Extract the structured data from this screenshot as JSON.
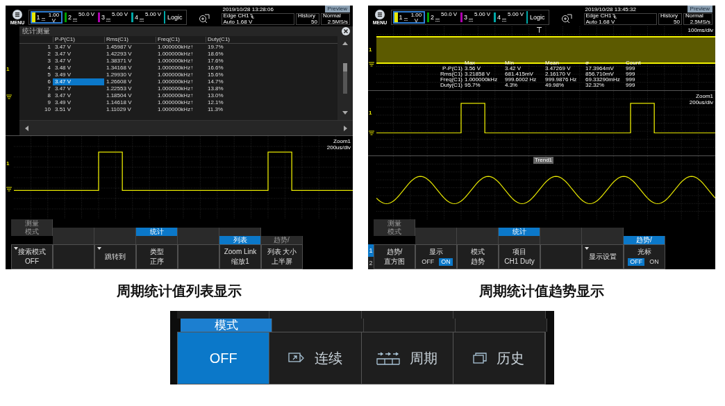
{
  "list_screen": {
    "header": {
      "menu_label": "MENU",
      "channels": [
        {
          "number": "1",
          "scale": "1.00 V",
          "color": "#e8e800",
          "selected": true
        },
        {
          "number": "2",
          "scale": "50.0 V",
          "color": "#00a000",
          "selected": false
        },
        {
          "number": "3",
          "scale": "5.00 V",
          "color": "#b000b0",
          "selected": false
        },
        {
          "number": "4",
          "scale": "5.00 V",
          "color": "#00a8a8",
          "selected": false
        }
      ],
      "logic": "Logic",
      "datetime": "2019/10/28 13:28:06",
      "preview": "Preview",
      "trigger": "Edge CH1",
      "trigger_level": "Auto 1.68 V",
      "history_label": "History",
      "history_value": "50",
      "acq_mode": "Normal",
      "sample_rate": "2.5MS/s"
    },
    "stats_window": {
      "title": "统计测量",
      "channel_marker": "1",
      "columns": [
        "P-P(C1)",
        "Rms(C1)",
        "Freq(C1)",
        "Duty(C1)"
      ],
      "rows": [
        {
          "index": "1",
          "cells": [
            "3.47 V",
            "1.45987 V",
            "1.000000kHz↑",
            "19.7%"
          ],
          "selected": false
        },
        {
          "index": "2",
          "cells": [
            "3.47 V",
            "1.42293 V",
            "1.000000kHz↑",
            "18.6%"
          ],
          "selected": false
        },
        {
          "index": "3",
          "cells": [
            "3.47 V",
            "1.38371 V",
            "1.000000kHz↑",
            "17.6%"
          ],
          "selected": false
        },
        {
          "index": "4",
          "cells": [
            "3.48 V",
            "1.34168 V",
            "1.000000kHz↑",
            "16.6%"
          ],
          "selected": false
        },
        {
          "index": "5",
          "cells": [
            "3.49 V",
            "1.29930 V",
            "1.000000kHz↑",
            "15.6%"
          ],
          "selected": false
        },
        {
          "index": "6",
          "cells": [
            "3.47 V",
            "1.26608 V",
            "1.000000kHz↑",
            "14.7%"
          ],
          "selected": true
        },
        {
          "index": "7",
          "cells": [
            "3.47 V",
            "1.22553 V",
            "1.000000kHz↑",
            "13.8%"
          ],
          "selected": false
        },
        {
          "index": "8",
          "cells": [
            "3.47 V",
            "1.18504 V",
            "1.000000kHz↑",
            "13.0%"
          ],
          "selected": false
        },
        {
          "index": "9",
          "cells": [
            "3.49 V",
            "1.14618 V",
            "1.000000kHz↑",
            "12.1%"
          ],
          "selected": false
        },
        {
          "index": "10",
          "cells": [
            "3.51 V",
            "1.11029 V",
            "1.000000kHz↑",
            "11.3%"
          ],
          "selected": false
        }
      ]
    },
    "zoom_display": {
      "title": "Zoom1",
      "timebase": "200us/div",
      "channel_marker": "1"
    },
    "menu": {
      "layers": [
        [
          {
            "label": "测量",
            "selected": false
          }
        ],
        [
          {
            "label": "模式",
            "selected": false
          },
          {
            "selected": false
          },
          {
            "selected": false
          },
          {
            "label": "统计",
            "selected": true
          },
          {
            "selected": false
          },
          {
            "selected": false
          }
        ],
        [
          {
            "selected": false
          },
          {
            "selected": false
          },
          {
            "selected": false
          },
          {
            "selected": false
          },
          {
            "label": "列表",
            "selected": true
          },
          {
            "label": "趋势/",
            "selected": false
          }
        ]
      ],
      "softkeys": [
        {
          "kind": "value",
          "label": "搜索模式",
          "value": "OFF",
          "dropdown": true
        },
        {
          "kind": "blank"
        },
        {
          "kind": "action",
          "lines": [
            "跳转到"
          ],
          "dropdown": true
        },
        {
          "kind": "value",
          "label": "类型",
          "value": "正序",
          "dropdown": false
        },
        {
          "kind": "blank"
        },
        {
          "kind": "value",
          "label": "Zoom Link",
          "value": "缩放1",
          "dropdown": false
        },
        {
          "kind": "value",
          "label": "列表 大小",
          "value": "上半屏",
          "dropdown": false
        }
      ]
    }
  },
  "list_caption": "周期统计值列表显示",
  "trend_screen": {
    "header": {
      "menu_label": "MENU",
      "channels": [
        {
          "number": "1",
          "scale": "1.00 V",
          "color": "#e8e800",
          "selected": true
        },
        {
          "number": "2",
          "scale": "50.0 V",
          "color": "#00a000",
          "selected": false
        },
        {
          "number": "3",
          "scale": "5.00 V",
          "color": "#b000b0",
          "selected": false
        },
        {
          "number": "4",
          "scale": "5.00 V",
          "color": "#00a8a8",
          "selected": false
        }
      ],
      "logic": "Logic",
      "datetime": "2019/10/28 13:45:32",
      "preview": "Preview",
      "trigger": "Edge CH1",
      "trigger_level": "Auto 1.68 V",
      "history_label": "History",
      "history_value": "50",
      "acq_mode": "Normal",
      "sample_rate": "2.5MS/s"
    },
    "overview": {
      "timebase": "100ms/div",
      "channel_marker": "1",
      "stats": {
        "columns": [
          "Max",
          "Min",
          "Mean",
          "σ",
          "Count"
        ],
        "rows": [
          {
            "label": "P-P(C1)",
            "cells": [
              "3.56 V",
              "3.42 V",
              "3.47269 V",
              "17.3964mV",
              "999"
            ]
          },
          {
            "label": "Rms(C1)",
            "cells": [
              "3.21858 V",
              "681.415mV",
              "2.16170 V",
              "856.710mV",
              "999"
            ]
          },
          {
            "label": "Freq(C1)",
            "cells": [
              "1.000000kHz",
              "999.6002 Hz",
              "999.9876 Hz",
              "69.33290mHz",
              "999"
            ]
          },
          {
            "label": "Duty(C1)",
            "cells": [
              "95.7%",
              "4.3%",
              "49.98%",
              "32.32%",
              "999"
            ]
          }
        ]
      }
    },
    "zoom_display": {
      "title": "Zoom1",
      "timebase": "200us/div",
      "channel_marker": "1"
    },
    "trend_display": {
      "title": "Trend1"
    },
    "menu": {
      "pages": [
        {
          "label": "1",
          "selected": true
        },
        {
          "label": "2",
          "selected": false
        }
      ],
      "layers": [
        [
          {
            "label": "测量",
            "selected": false
          }
        ],
        [
          {
            "label": "模式",
            "selected": false
          },
          {
            "selected": false
          },
          {
            "selected": false
          },
          {
            "label": "统计",
            "selected": true
          },
          {
            "selected": false
          },
          {
            "selected": false
          }
        ],
        [
          {
            "selected": false
          },
          {
            "selected": false
          },
          {
            "selected": false
          },
          {
            "selected": false
          },
          {
            "selected": false
          },
          {
            "label": "趋势/",
            "selected": true
          }
        ]
      ],
      "softkeys": [
        {
          "kind": "action",
          "lines": [
            "趋势/",
            "直方图"
          ],
          "dropdown": false
        },
        {
          "kind": "toggle",
          "label": "显示",
          "options": [
            {
              "label": "OFF",
              "selected": false
            },
            {
              "label": "ON",
              "selected": true
            }
          ]
        },
        {
          "kind": "value",
          "label": "模式",
          "value": "趋势",
          "dropdown": false
        },
        {
          "kind": "value",
          "label": "项目",
          "value": "CH1 Duty",
          "dropdown": false
        },
        {
          "kind": "blank"
        },
        {
          "kind": "action",
          "lines": [
            "显示设置"
          ],
          "dropdown": true
        },
        {
          "kind": "toggle",
          "label": "光标",
          "options": [
            {
              "label": "OFF",
              "selected": true
            },
            {
              "label": "ON",
              "selected": false
            }
          ]
        }
      ]
    }
  },
  "trend_caption": "周期统计值趋势显示",
  "mode_menu": {
    "tabs": [
      {
        "label": "模式",
        "selected": true
      },
      {
        "selected": false
      },
      {
        "selected": false
      },
      {
        "selected": false
      }
    ],
    "options": [
      {
        "kind": "off",
        "label": "OFF",
        "selected": true
      },
      {
        "kind": "continuous",
        "label": "连续",
        "selected": false
      },
      {
        "kind": "cycle",
        "label": "周期",
        "selected": false
      },
      {
        "kind": "history",
        "label": "历史",
        "selected": false
      }
    ]
  }
}
